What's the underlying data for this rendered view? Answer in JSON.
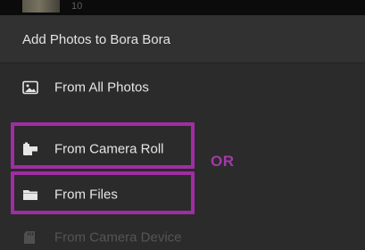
{
  "top": {
    "photo_count": "10"
  },
  "panel": {
    "title": "Add Photos to Bora Bora",
    "items": [
      {
        "label": "From All Photos",
        "icon": "image-icon",
        "enabled": true
      },
      {
        "label": "From Camera Roll",
        "icon": "camera-roll-icon",
        "enabled": true
      },
      {
        "label": "From Files",
        "icon": "folder-icon",
        "enabled": true
      },
      {
        "label": "From Camera Device",
        "icon": "sd-card-icon",
        "enabled": false
      }
    ]
  },
  "annotation": {
    "or_text": "OR",
    "highlight_color": "#a02da3"
  }
}
